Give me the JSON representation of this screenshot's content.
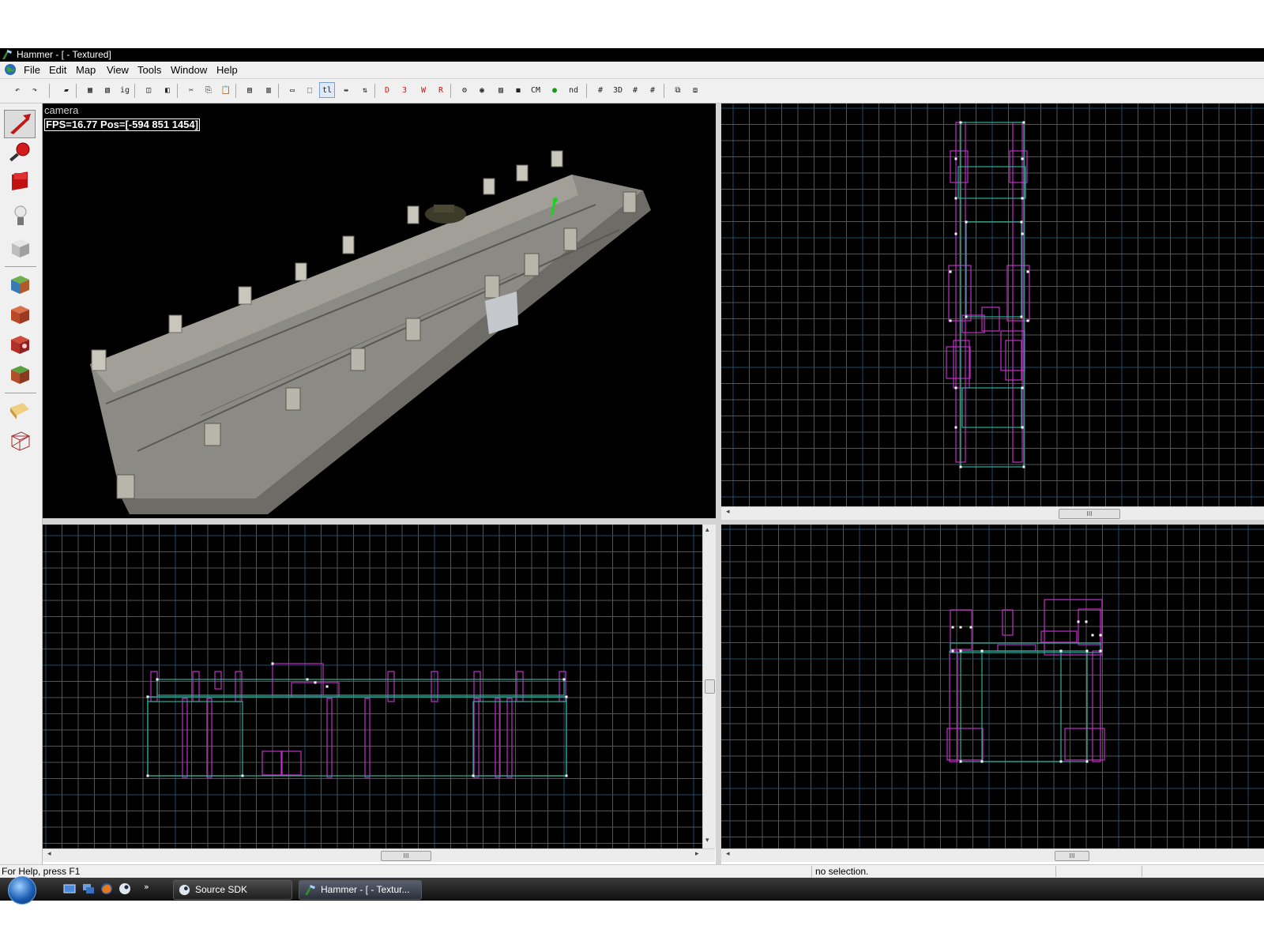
{
  "window": {
    "title": "Hammer - [ - Textured]"
  },
  "menubar": {
    "items": [
      "File",
      "Edit",
      "Map",
      "View",
      "Tools",
      "Window",
      "Help"
    ]
  },
  "toolbar": {
    "buttons": [
      {
        "name": "undo-button",
        "glyph": "↶"
      },
      {
        "name": "redo-button",
        "glyph": "↷"
      },
      {
        "name": "carve-button",
        "glyph": "▰"
      },
      {
        "name": "group-button",
        "glyph": "▦"
      },
      {
        "name": "ungroup-button",
        "glyph": "▧"
      },
      {
        "name": "ignore-group-button",
        "glyph": "ig"
      },
      {
        "name": "hide-button",
        "glyph": "◫"
      },
      {
        "name": "unhide-button",
        "glyph": "◧"
      },
      {
        "name": "cut-button",
        "glyph": "✂"
      },
      {
        "name": "copy-button",
        "glyph": "⎘"
      },
      {
        "name": "paste-button",
        "glyph": "📋"
      },
      {
        "name": "texture-lock-button",
        "glyph": "▤"
      },
      {
        "name": "texture-scale-lock-button",
        "glyph": "▥"
      },
      {
        "name": "select-box-button",
        "glyph": "▭"
      },
      {
        "name": "select-within-button",
        "glyph": "⬚"
      },
      {
        "name": "tl-button",
        "glyph": "tl"
      },
      {
        "name": "flip-horizontal-button",
        "glyph": "⇹"
      },
      {
        "name": "flip-vertical-button",
        "glyph": "⇅"
      },
      {
        "name": "view-3d-button",
        "glyph": "D"
      },
      {
        "name": "view-3d-wire-button",
        "glyph": "3"
      },
      {
        "name": "view-3d-textured-button",
        "glyph": "W"
      },
      {
        "name": "view-3d-lighting-button",
        "glyph": "R"
      },
      {
        "name": "entity-report-button",
        "glyph": "⚙"
      },
      {
        "name": "map-check-button",
        "glyph": "◉"
      },
      {
        "name": "wireframe-button",
        "glyph": "▨"
      },
      {
        "name": "cubes-button",
        "glyph": "◼"
      },
      {
        "name": "cm-button",
        "glyph": "CM"
      },
      {
        "name": "green-leaf-button",
        "glyph": "●"
      },
      {
        "name": "no-draw-button",
        "glyph": "nd"
      },
      {
        "name": "grid-toggle-button",
        "glyph": "#"
      },
      {
        "name": "grid-3d-button",
        "glyph": "3D"
      },
      {
        "name": "grid-smaller-button",
        "glyph": "#"
      },
      {
        "name": "grid-larger-button",
        "glyph": "#"
      },
      {
        "name": "window-tile-button",
        "glyph": "⧉"
      },
      {
        "name": "window-cascade-button",
        "glyph": "⧈"
      }
    ]
  },
  "viewport3d": {
    "label": "camera",
    "fps_text": "FPS=16.77 Pos=[-594 851 1454]"
  },
  "tools": [
    "selection-tool",
    "magnify-tool",
    "camera-tool",
    "entity-tool",
    "block-tool",
    "texture-application-tool",
    "apply-current-texture-tool",
    "decal-tool",
    "overlay-tool",
    "clipping-tool",
    "vertex-tool"
  ],
  "status": {
    "help": "For Help, press F1",
    "selection": "no selection."
  },
  "taskbar": {
    "tasks": [
      {
        "label": "Source SDK"
      },
      {
        "label": "Hammer - [ - Textur..."
      }
    ]
  },
  "colors": {
    "grid_minor": "#555555",
    "grid_major": "#1f4c6a",
    "grid_axis": "#6a2a1a",
    "brush_magenta": "#c030c8",
    "brush_teal": "#2ab09a",
    "vertex": "#ffffff"
  }
}
